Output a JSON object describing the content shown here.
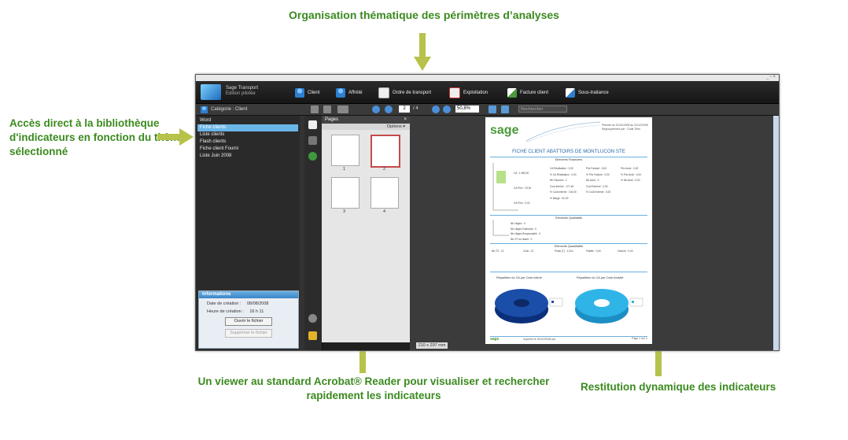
{
  "callouts": {
    "top": "Organisation thématique des périmètres d’analyses",
    "left": "Accès direct à la bibliothèque d'indicateurs en fonction du thème sélectionné",
    "bottom": "Un viewer au standard Acrobat® Reader pour visualiser et rechercher rapidement les indicateurs",
    "right": "Restitution dynamique des indicateurs"
  },
  "app": {
    "name_line1": "Sage Transport",
    "name_line2": "Edition pilotée",
    "nav": [
      "Client",
      "Affrété",
      "Ordre de transport",
      "Exploitation",
      "Facture client",
      "Sous-traitance"
    ],
    "category_label": "Catégorie : Client",
    "page_current": "2",
    "page_total": "/ 4",
    "zoom": "50,8%",
    "search_placeholder": "Rechercher",
    "list_items": [
      "Word",
      "Fiche clients",
      "Liste clients",
      "Flash clients",
      "Fiche client Fourni",
      "Liste Juin 2008"
    ],
    "selected_index": 1,
    "info": {
      "title": "Informations",
      "date_label": "Date de création :",
      "date_value": "08/08/2008",
      "time_label": "Heure de création :",
      "time_value": "16 h 11",
      "open_button": "Ouvrir le fichier",
      "delete_button": "Supprimer le fichier"
    },
    "pages_panel": {
      "title": "Pages",
      "close": "×",
      "options": "Options ▾",
      "thumb_numbers": [
        "1",
        "2",
        "3",
        "4"
      ],
      "selected_thumb": 1
    },
    "page_size": "210 x 297 mm",
    "window_controls": "_ ▫ ×"
  },
  "document": {
    "brand": "sage",
    "header_line1": "Période du 01/01/2008 au 31/12/2008",
    "header_line2": "Regroupement par : Code Tiers",
    "title": "FICHE CLIENT ABATTOIRS DE MONTLUCON STE",
    "section1": "Eléments Financiers",
    "section2": "Eléments Qualitatifs",
    "section3": "Eléments Quantitatifs",
    "pie1_title": "Répartition du CA par Code Article",
    "pie2_title": "Répartition du CA par Code Activité",
    "fin_left": [
      "CA : 1 893,00",
      "CA Prév : 23,00",
      "CA Préc : 0,00"
    ],
    "fin_mid": [
      "CA Réalisation : 0,00",
      "% CA Réalisation : 0,00",
      "Nb Factures : 1",
      "Coût Interne : 177,46",
      "% Coût Interne : 100,00",
      "% Marge : 92,00"
    ],
    "fin_right1": [
      "Prix Facturé : 0,00",
      "% Prix Facturé : 0,00",
      "Nb Avoir : 0",
      "Coût Externe : 0,00",
      "% Coût Externe : 0,00"
    ],
    "fin_right2": [
      "Prix Avoir : 0,00",
      "% Prix Avoir : 0,00",
      "% Nb Avoir : 0,00"
    ],
    "qual_rows": [
      "Nb Litiges : 0",
      "Nb Litiges Fabricant : 0",
      "Nb Litiges Responsable : 0",
      "Nb OT en retard : 0"
    ],
    "quant_rows": [
      "Nb OT : 12",
      "Colis : 12",
      "Poids (T) : 1,014",
      "Palette : 0,00",
      "Volume : 0,00"
    ],
    "footer_left": "sage",
    "footer_mid": "Imprimé le 30/10/2008 par",
    "footer_right": "Page 1 sur 1"
  }
}
